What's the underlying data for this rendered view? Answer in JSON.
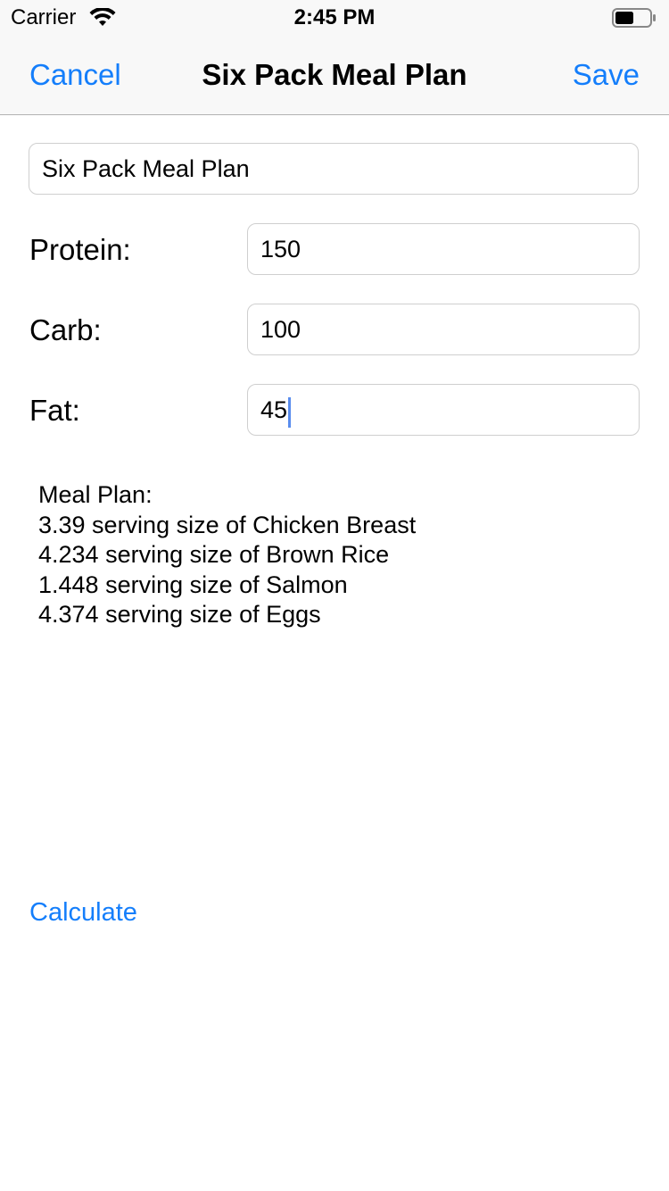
{
  "status_bar": {
    "carrier": "Carrier",
    "time": "2:45 PM",
    "icons": [
      "wifi-icon",
      "battery-icon"
    ]
  },
  "nav": {
    "cancel_label": "Cancel",
    "title": "Six Pack Meal Plan",
    "save_label": "Save"
  },
  "form": {
    "plan_name_value": "Six Pack Meal Plan",
    "protein_label": "Protein:",
    "protein_value": "150",
    "carb_label": "Carb:",
    "carb_value": "100",
    "fat_label": "Fat:",
    "fat_value": "45"
  },
  "meal_plan": {
    "heading": "Meal Plan:",
    "lines": [
      "3.39 serving size of Chicken Breast",
      "4.234 serving size of Brown Rice",
      "1.448 serving size of Salmon",
      "4.374 serving size of Eggs"
    ]
  },
  "actions": {
    "calculate_label": "Calculate"
  },
  "colors": {
    "accent": "#147efb",
    "caret": "#5a8dee",
    "bar_background": "#f8f8f8",
    "field_border": "#cfcfcf"
  }
}
